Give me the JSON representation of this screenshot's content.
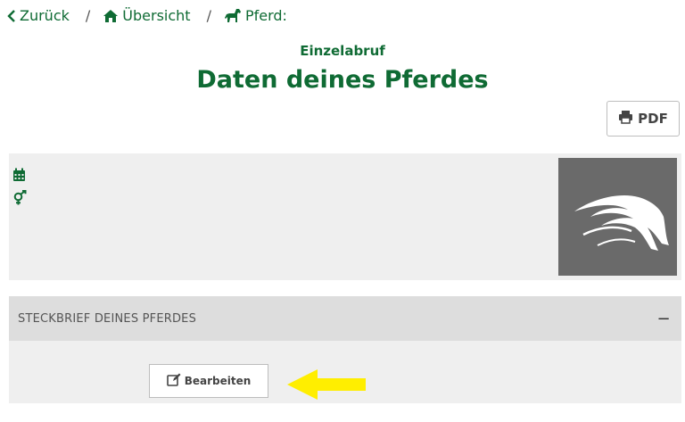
{
  "breadcrumb": {
    "back_label": "Zurück",
    "overview_label": "Übersicht",
    "horse_label": "Pferd:",
    "separator": "/"
  },
  "header": {
    "subtitle": "Einzelabruf",
    "title": "Daten deines Pferdes"
  },
  "toolbar": {
    "pdf_label": "PDF"
  },
  "info": {
    "birth_date_icon": "calendar-icon",
    "gender_icon": "gender-icon"
  },
  "accordion": {
    "title": "STECKBRIEF DEINES PFERDES",
    "toggle_symbol": "−",
    "edit_label": "Bearbeiten"
  },
  "colors": {
    "brand_green": "#0f6b34",
    "panel_grey": "#efefef",
    "header_grey": "#dddddd",
    "arrow_yellow": "#ffee00"
  }
}
